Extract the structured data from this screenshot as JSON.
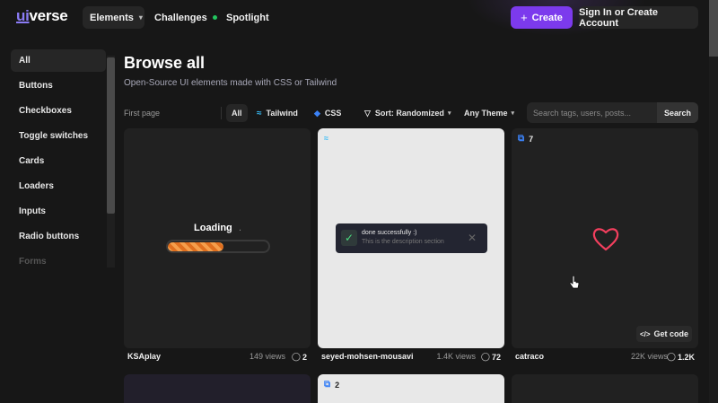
{
  "header": {
    "logo": {
      "ui": "ui",
      "verse": "verse"
    },
    "nav": [
      {
        "label": "Elements"
      },
      {
        "label": "Challenges"
      },
      {
        "label": "Spotlight"
      }
    ],
    "create_label": "Create",
    "signin_label": "Sign In or Create Account"
  },
  "sidebar": {
    "items": [
      {
        "label": "All"
      },
      {
        "label": "Buttons"
      },
      {
        "label": "Checkboxes"
      },
      {
        "label": "Toggle switches"
      },
      {
        "label": "Cards"
      },
      {
        "label": "Loaders"
      },
      {
        "label": "Inputs"
      },
      {
        "label": "Radio buttons"
      },
      {
        "label": "Forms"
      }
    ]
  },
  "main": {
    "title": "Browse all",
    "subtitle": "Open-Source UI elements made with CSS or Tailwind",
    "first_page": "First page",
    "filters": {
      "all": "All",
      "tailwind": "Tailwind",
      "css": "CSS",
      "sort": "Sort: Randomized",
      "theme": "Any Theme"
    },
    "search": {
      "placeholder": "Search tags, users, posts...",
      "button": "Search"
    }
  },
  "cards": [
    {
      "author": "KSAplay",
      "views": "149 views",
      "saves": "2",
      "preview": {
        "loading_text": "Loading",
        "loading_dot": ".",
        "progress": 0.55
      }
    },
    {
      "author": "seyed-mohsen-mousavi",
      "views": "1.4K views",
      "saves": "72",
      "tag_icon": "tailwind-icon",
      "preview": {
        "toast_title": "done successfully :)",
        "toast_desc": "This is the description section"
      }
    },
    {
      "author": "catraco",
      "views": "22K views",
      "saves": "1.2K",
      "variants": "7",
      "get_code": "Get code",
      "preview": {
        "heart_color": "#f43f5e"
      }
    }
  ],
  "cards_row2": [
    {},
    {
      "variants": "2"
    },
    {}
  ],
  "colors": {
    "accent": "#7c3aed",
    "tailwind": "#38bdf8",
    "css": "#3b82f6"
  }
}
